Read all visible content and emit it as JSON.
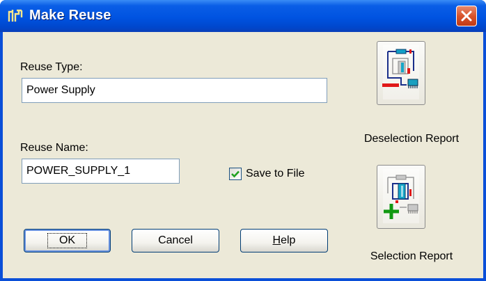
{
  "window": {
    "title": "Make Reuse"
  },
  "form": {
    "reuse_type_label": "Reuse Type:",
    "reuse_type_value": "Power Supply",
    "reuse_name_label": "Reuse Name:",
    "reuse_name_value": "POWER_SUPPLY_1",
    "save_to_file_label": "Save to File",
    "save_to_file_checked": true
  },
  "buttons": {
    "ok": "OK",
    "cancel": "Cancel",
    "help_prefix": "H",
    "help_rest": "elp"
  },
  "reports": {
    "deselection_label": "Deselection Report",
    "selection_label": "Selection Report"
  },
  "icons": {
    "app": "reuse-app-icon",
    "close": "close-icon",
    "deselection": "deselection-report-icon",
    "selection": "selection-report-icon",
    "checkmark": "checkmark-icon"
  },
  "colors": {
    "title_blue": "#0053e1",
    "client_bg": "#ece9d8",
    "close_red": "#d9542c",
    "minus_red": "#e01818",
    "plus_green": "#119911"
  }
}
